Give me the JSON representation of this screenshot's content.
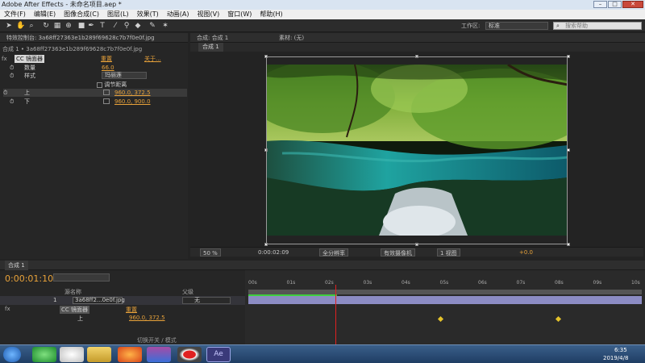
{
  "window": {
    "title": "Adobe After Effects - 未命名项目.aep *"
  },
  "menu": [
    "文件(F)",
    "编辑(E)",
    "图像合成(C)",
    "图层(L)",
    "效果(T)",
    "动画(A)",
    "视图(V)",
    "窗口(W)",
    "帮助(H)"
  ],
  "toolbar": {
    "workspace_label": "工作区:",
    "workspace_value": "标准",
    "search_placeholder": "搜索帮助"
  },
  "effects_panel": {
    "tab": "特效控制台: 3a68ff27363e1b289f69628c7b7f0e0f.jpg",
    "layer_path": "合成 1 • 3a68ff27363e1b289f69628c7b7f0e0f.jpg",
    "effect_name": "CC 镜面器",
    "reset": "重置",
    "about": "关于...",
    "rows": [
      {
        "label": "数量",
        "value": "66.0"
      },
      {
        "label": "样式",
        "value": "玛丽莲"
      },
      {
        "label": "",
        "value": "调节距离"
      },
      {
        "label": "上",
        "value": "960.0, 372.5"
      },
      {
        "label": "下",
        "value": "960.0, 900.0"
      }
    ]
  },
  "comp_panel": {
    "tab": "合成: 合成 1",
    "footage_tab": "素材: (无)",
    "sub_tab": "合成 1"
  },
  "viewer_status": {
    "zoom": "50 %",
    "timecode": "0:00:02:09",
    "resolution": "全分辨率",
    "camera": "有效摄像机",
    "views": "1 视图",
    "exposure": "+0.0"
  },
  "timeline": {
    "tab": "合成 1",
    "current_time": "0:00:01:10",
    "col_source": "源名称",
    "col_parent": "父级",
    "layer_index": "1",
    "layer_name": "3a68ff2...0e0f.jpg",
    "parent_value": "无",
    "effect_row": "CC 镜面器",
    "effect_reset": "重置",
    "prop_label": "上",
    "prop_value": "960.0, 372.5",
    "footer": "切换开关 / 模式",
    "ruler": [
      "00s",
      "01s",
      "02s",
      "03s",
      "04s",
      "05s",
      "06s",
      "07s",
      "08s",
      "09s",
      "10s"
    ]
  },
  "clock": {
    "time": "6:35",
    "date": "2019/4/8"
  }
}
